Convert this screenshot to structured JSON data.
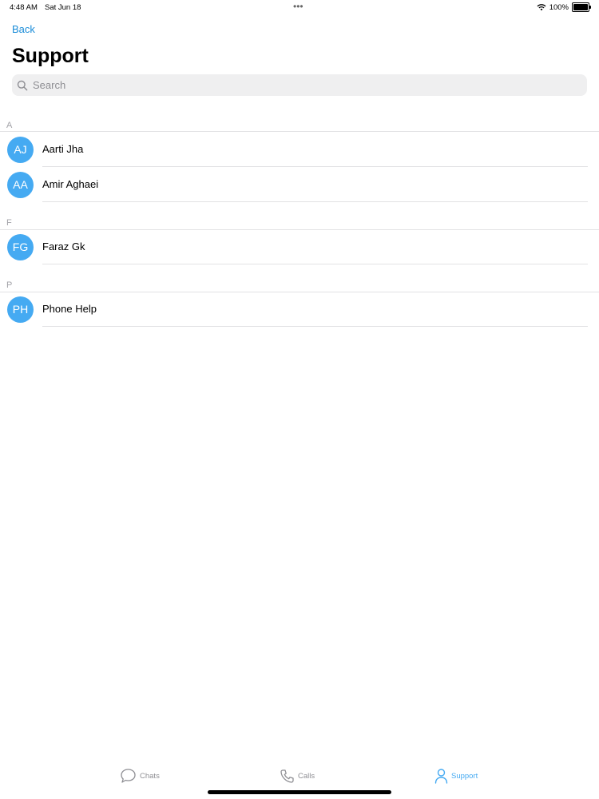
{
  "status_bar": {
    "time": "4:48 AM",
    "date": "Sat Jun 18",
    "dots": "•••",
    "battery": "100%"
  },
  "nav": {
    "back_label": "Back",
    "title": "Support"
  },
  "search": {
    "placeholder": "Search"
  },
  "sections": [
    {
      "letter": "A",
      "contacts": [
        {
          "initials": "AJ",
          "name": "Aarti Jha"
        },
        {
          "initials": "AA",
          "name": "Amir Aghaei"
        }
      ]
    },
    {
      "letter": "F",
      "contacts": [
        {
          "initials": "FG",
          "name": "Faraz Gk"
        }
      ]
    },
    {
      "letter": "P",
      "contacts": [
        {
          "initials": "PH",
          "name": "Phone Help"
        }
      ]
    }
  ],
  "tabs": [
    {
      "label": "Chats",
      "icon": "chat-bubble-icon",
      "active": false
    },
    {
      "label": "Calls",
      "icon": "phone-icon",
      "active": false
    },
    {
      "label": "Support",
      "icon": "person-icon",
      "active": true
    }
  ],
  "colors": {
    "accent": "#1a8cd8",
    "avatar": "#45aaf2",
    "active_tab": "#45aaf2",
    "inactive_tab": "#8e8e93"
  }
}
